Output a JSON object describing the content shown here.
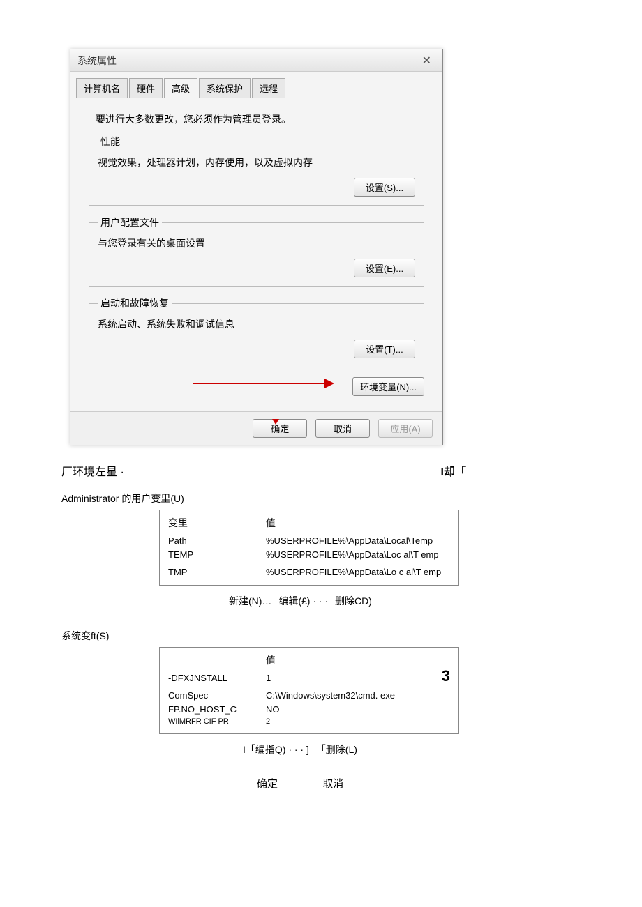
{
  "dialog": {
    "title": "系统属性",
    "close": "✕",
    "tabs": [
      "计算机名",
      "硬件",
      "高级",
      "系统保护",
      "远程"
    ],
    "active_tab": 2,
    "intro": "要进行大多数更改，您必须作为管理员登录。",
    "sections": {
      "perf": {
        "title": "性能",
        "desc": "视觉效果，处理器计划，内存使用，以及虚拟内存",
        "btn": "设置(S)..."
      },
      "profile": {
        "title": "用户配置文件",
        "desc": "与您登录有关的桌面设置",
        "btn": "设置(E)..."
      },
      "startup": {
        "title": "启动和故障恢复",
        "desc": "系统启动、系统失败和调试信息",
        "btn": "设置(T)..."
      }
    },
    "env_btn": "环境变量(N)...",
    "footer": {
      "ok": "确定",
      "cancel": "取消",
      "apply": "应用(A)"
    }
  },
  "below": {
    "header_left": "厂环境左星   ·",
    "header_right": "I却「",
    "user_vars_label": "Administrator 的用户变里(U)",
    "user_table": {
      "h1": "变里",
      "h2": "值",
      "rows": [
        {
          "name": "Path",
          "value": "%USERPROFILE%\\AppData\\Local\\Temp"
        },
        {
          "name": "TEMP",
          "value": "%USERPROFILE%\\AppData\\Loc al\\T emp"
        },
        {
          "name": "TMP",
          "value": "%USERPROFILE%\\AppData\\Lo c al\\T emp"
        }
      ]
    },
    "user_btns": {
      "new": "新建(N)…",
      "edit": "编辑(£) · · ·",
      "del": "删除CD)"
    },
    "sys_vars_label": "系统变ft(S)",
    "sys_table": {
      "h2": "值",
      "side": "3",
      "rows": [
        {
          "name": "-DFXJNSTALL",
          "value": "1"
        },
        {
          "name": "ComSpec",
          "value": "C:\\Windows\\system32\\cmd. exe"
        },
        {
          "name": "FP.NO_HOST_C",
          "value": "NO"
        },
        {
          "name": "WIlMRFR CIF PR",
          "value": "2"
        }
      ]
    },
    "sys_btns": {
      "edit": "I「编指Q) · · · ]",
      "del": "「删除(L)"
    },
    "final": {
      "ok": "确定",
      "cancel": "取消"
    }
  }
}
